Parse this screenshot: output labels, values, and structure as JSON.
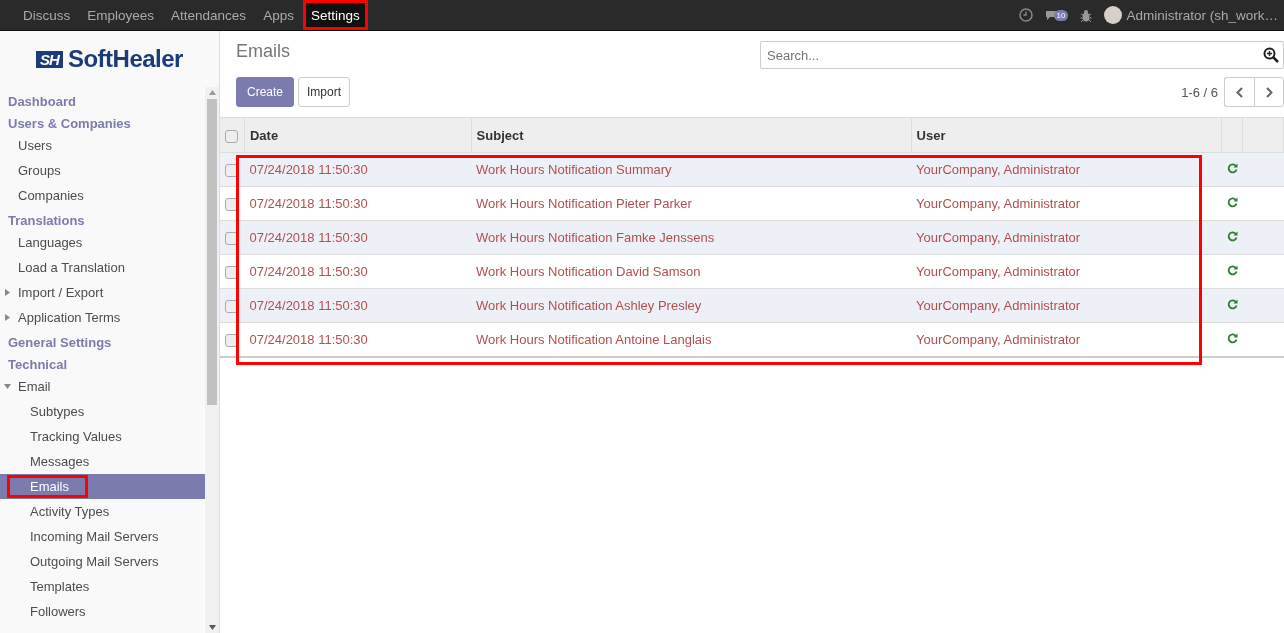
{
  "top_menu": [
    {
      "label": "Discuss",
      "selected": false
    },
    {
      "label": "Employees",
      "selected": false
    },
    {
      "label": "Attendances",
      "selected": false
    },
    {
      "label": "Apps",
      "selected": false
    },
    {
      "label": "Settings",
      "selected": true
    }
  ],
  "systray": {
    "message_count": "10",
    "user": "Administrator (sh_work…"
  },
  "sidebar": {
    "logo_mark": "SH",
    "logo_text": "SoftHealer",
    "sections": [
      {
        "title": "Dashboard"
      },
      {
        "title": "Users & Companies",
        "items": [
          {
            "label": "Users",
            "selected": false
          },
          {
            "label": "Groups",
            "selected": false
          },
          {
            "label": "Companies",
            "selected": false
          }
        ]
      },
      {
        "title": "Translations",
        "items": [
          {
            "label": "Languages",
            "selected": false
          },
          {
            "label": "Load a Translation",
            "selected": false
          },
          {
            "label": "Import / Export",
            "selected": false,
            "expanded": false
          },
          {
            "label": "Application Terms",
            "selected": false,
            "expanded": false
          }
        ]
      },
      {
        "title": "General Settings"
      },
      {
        "title": "Technical",
        "items": [
          {
            "label": "Email",
            "selected": false,
            "expanded": true,
            "children": [
              {
                "label": "Subtypes",
                "selected": false
              },
              {
                "label": "Tracking Values",
                "selected": false
              },
              {
                "label": "Messages",
                "selected": false
              },
              {
                "label": "Emails",
                "selected": true
              },
              {
                "label": "Activity Types",
                "selected": false
              },
              {
                "label": "Incoming Mail Servers",
                "selected": false
              },
              {
                "label": "Outgoing Mail Servers",
                "selected": false
              },
              {
                "label": "Templates",
                "selected": false
              },
              {
                "label": "Followers",
                "selected": false
              }
            ]
          }
        ]
      }
    ]
  },
  "page": {
    "title": "Emails",
    "buttons": [
      "Create",
      "Import"
    ],
    "search": {
      "placeholder": "Search..."
    },
    "pager": "1-6 / 6"
  },
  "table": {
    "select_all_checked": false,
    "columns": [
      "Date",
      "Subject",
      "User"
    ],
    "rows": [
      {
        "checked": false,
        "date": "07/24/2018 11:50:30",
        "subject": "Work Hours Notification Summary",
        "user": "YourCompany, Administrator"
      },
      {
        "checked": false,
        "date": "07/24/2018 11:50:30",
        "subject": "Work Hours Notification Pieter Parker",
        "user": "YourCompany, Administrator"
      },
      {
        "checked": false,
        "date": "07/24/2018 11:50:30",
        "subject": "Work Hours Notification Famke Jenssens",
        "user": "YourCompany, Administrator"
      },
      {
        "checked": false,
        "date": "07/24/2018 11:50:30",
        "subject": "Work Hours Notification David Samson",
        "user": "YourCompany, Administrator"
      },
      {
        "checked": false,
        "date": "07/24/2018 11:50:30",
        "subject": "Work Hours Notification Ashley Presley",
        "user": "YourCompany, Administrator"
      },
      {
        "checked": false,
        "date": "07/24/2018 11:50:30",
        "subject": "Work Hours Notification Antoine Langlais",
        "user": "YourCompany, Administrator"
      }
    ]
  }
}
